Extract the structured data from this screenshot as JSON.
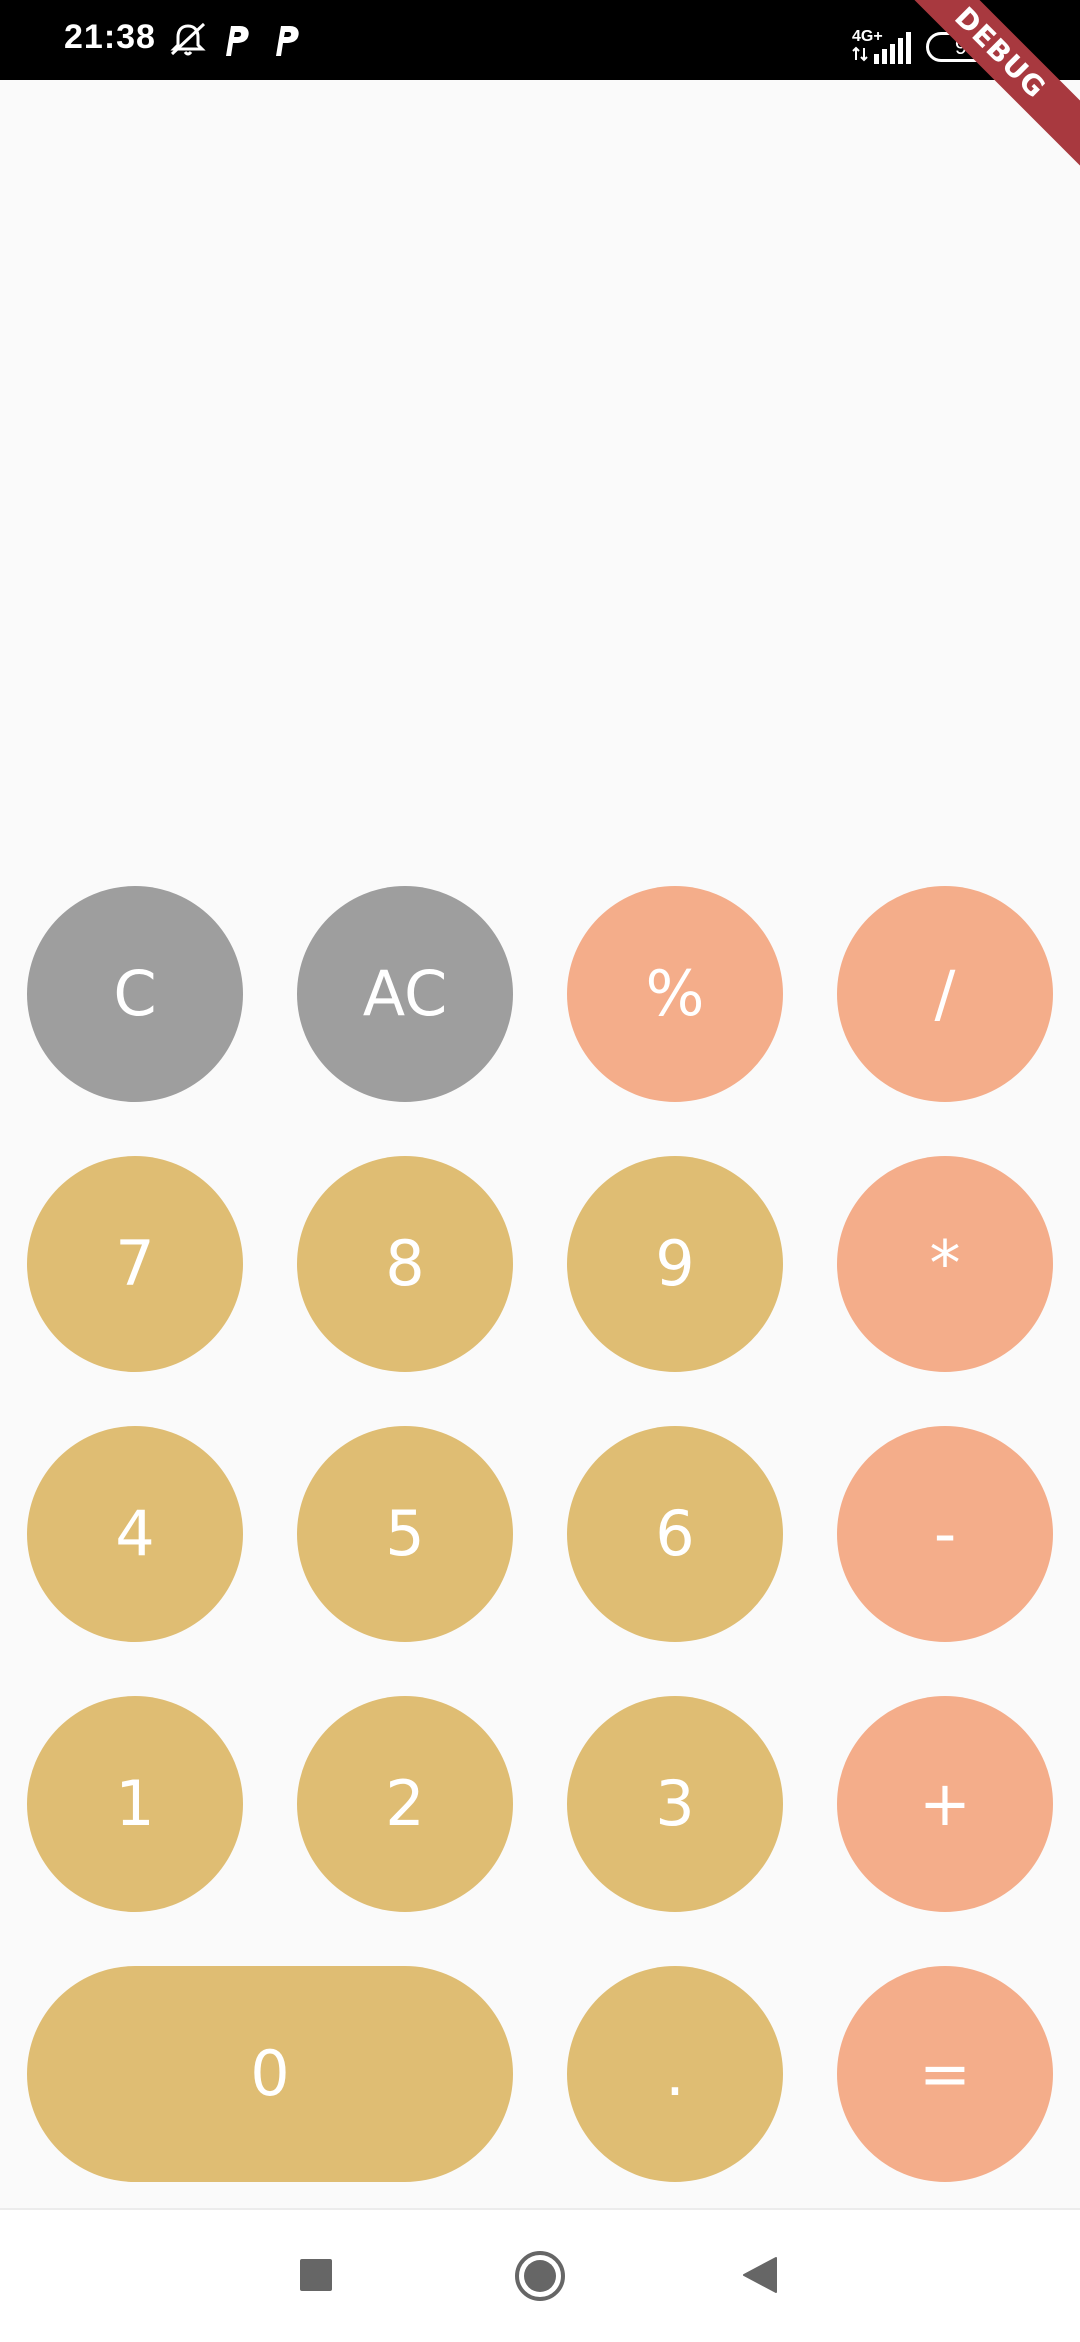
{
  "status_bar": {
    "time": "21:38",
    "icons": [
      "vibrate-off-icon",
      "parking-app-icon",
      "parking-app-icon",
      "network-4g-icon",
      "signal-icon",
      "battery-icon"
    ],
    "network_label": "4G+",
    "battery_level": "9",
    "debug_banner": "DEBUG"
  },
  "keypad": {
    "rows": [
      [
        {
          "label": "C",
          "kind": "function"
        },
        {
          "label": "AC",
          "kind": "function"
        },
        {
          "label": "%",
          "kind": "operator"
        },
        {
          "label": "/",
          "kind": "operator"
        }
      ],
      [
        {
          "label": "7",
          "kind": "number"
        },
        {
          "label": "8",
          "kind": "number"
        },
        {
          "label": "9",
          "kind": "number"
        },
        {
          "label": "*",
          "kind": "operator"
        }
      ],
      [
        {
          "label": "4",
          "kind": "number"
        },
        {
          "label": "5",
          "kind": "number"
        },
        {
          "label": "6",
          "kind": "number"
        },
        {
          "label": "-",
          "kind": "operator"
        }
      ],
      [
        {
          "label": "1",
          "kind": "number"
        },
        {
          "label": "2",
          "kind": "number"
        },
        {
          "label": "3",
          "kind": "number"
        },
        {
          "label": "+",
          "kind": "operator"
        }
      ],
      [
        {
          "label": "0",
          "kind": "number"
        },
        {
          "label": ".",
          "kind": "number"
        },
        {
          "label": "=",
          "kind": "operator"
        }
      ]
    ]
  },
  "colors": {
    "function": "#9e9e9e",
    "operator": "#f4ad8a",
    "number": "#dfbd73",
    "background": "#fafafa"
  },
  "nav_bar": {
    "icons": [
      "recents-square-icon",
      "home-circle-icon",
      "back-triangle-icon"
    ]
  }
}
